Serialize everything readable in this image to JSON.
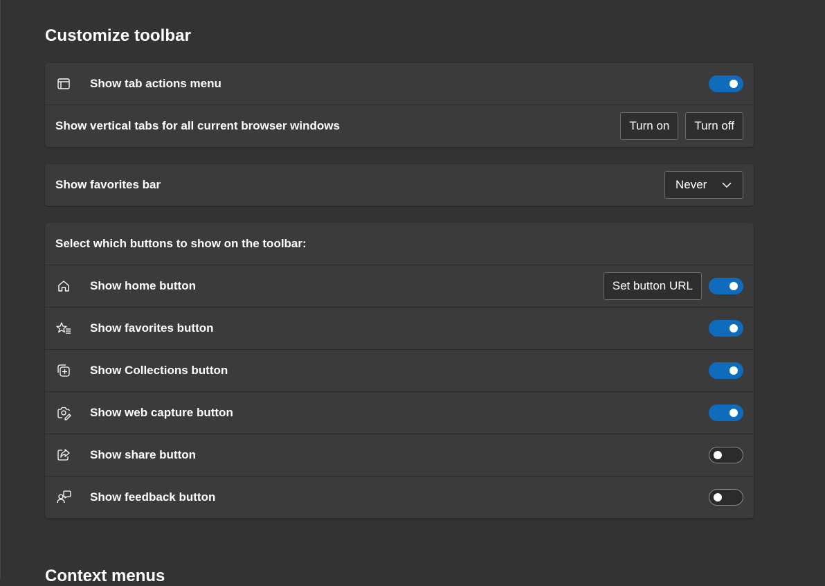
{
  "page": {
    "title": "Customize toolbar",
    "next_section_title": "Context menus"
  },
  "colors": {
    "background": "#333333",
    "card": "#3b3b3b",
    "toggle_on": "#0f6cbd"
  },
  "card_tab": {
    "tab_actions": {
      "label": "Show tab actions menu",
      "icon": "tab-actions-icon",
      "toggle": true
    },
    "vertical_tabs": {
      "label": "Show vertical tabs for all current browser windows",
      "turn_on": "Turn on",
      "turn_off": "Turn off"
    }
  },
  "card_favorites": {
    "label": "Show favorites bar",
    "selected": "Never"
  },
  "card_buttons": {
    "header": "Select which buttons to show on the toolbar:",
    "items": [
      {
        "label": "Show home button",
        "icon": "home-icon",
        "toggle": true,
        "extra_button": "Set button URL"
      },
      {
        "label": "Show favorites button",
        "icon": "favorites-star-icon",
        "toggle": true
      },
      {
        "label": "Show Collections button",
        "icon": "collections-icon",
        "toggle": true
      },
      {
        "label": "Show web capture button",
        "icon": "web-capture-icon",
        "toggle": true
      },
      {
        "label": "Show share button",
        "icon": "share-icon",
        "toggle": false
      },
      {
        "label": "Show feedback button",
        "icon": "feedback-icon",
        "toggle": false
      }
    ]
  }
}
